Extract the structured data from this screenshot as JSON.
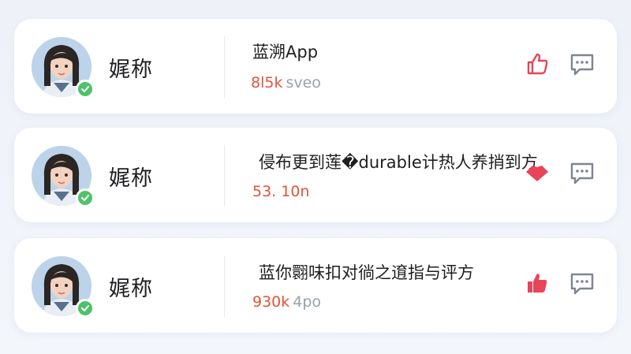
{
  "colors": {
    "accent_red": "#e0543a",
    "like_red": "#e8445a",
    "verified_green": "#4fc16b",
    "icon_gray": "#7d8590"
  },
  "posts": [
    {
      "user_name": "娓称",
      "title": "蓝溯App",
      "count": "8l5k",
      "meta": "sveo",
      "like_icon": "thumbs-up-outline-icon",
      "comment_icon": "comment-icon"
    },
    {
      "user_name": "娓称",
      "title": "侵布更到莲�durable计热人养捎到方",
      "count": "53. 10n",
      "meta": "",
      "like_icon": "heart-filled-icon",
      "comment_icon": "comment-icon"
    },
    {
      "user_name": "娓称",
      "title": "蓝你翾味扣对徜之逳指与评方",
      "count": "930k",
      "meta": "4po",
      "like_icon": "thumbs-up-filled-icon",
      "comment_icon": "comment-icon"
    }
  ]
}
